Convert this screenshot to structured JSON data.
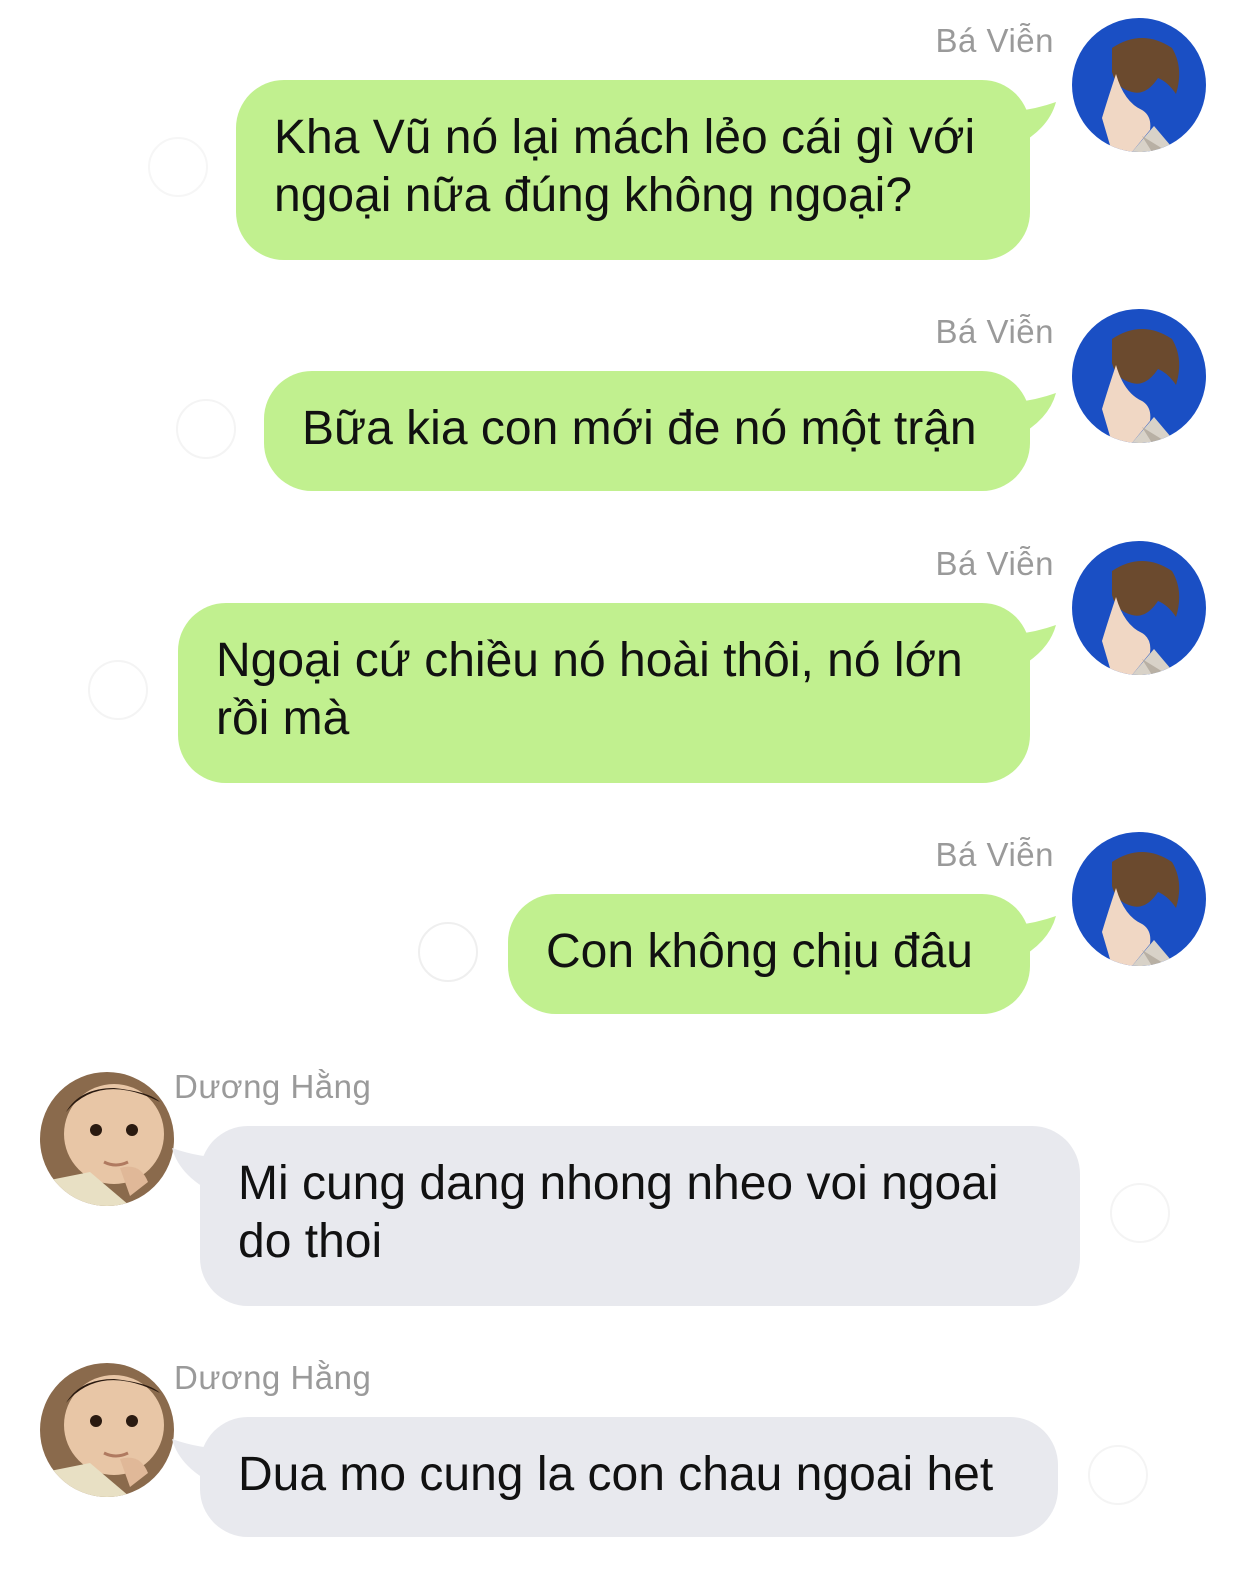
{
  "colors": {
    "outgoing_bubble": "#c1f08f",
    "incoming_bubble": "#e8e9ee",
    "sender_name": "#9a9a9a",
    "background": "#ffffff"
  },
  "messages": [
    {
      "direction": "outgoing",
      "sender": "Bá Viễn",
      "text": "Kha Vũ nó lại mách lẻo cái gì với\nngoại nữa đúng không ngoại?",
      "avatar": "boy-profile-blue-avatar"
    },
    {
      "direction": "outgoing",
      "sender": "Bá Viễn",
      "text": "Bữa kia con mới đe nó một trận",
      "avatar": "boy-profile-blue-avatar"
    },
    {
      "direction": "outgoing",
      "sender": "Bá Viễn",
      "text": "Ngoại cứ chiều nó hoài thôi, nó lớn\nrồi mà",
      "avatar": "boy-profile-blue-avatar"
    },
    {
      "direction": "outgoing",
      "sender": "Bá Viễn",
      "text": "Con không chịu đâu",
      "avatar": "boy-profile-blue-avatar"
    },
    {
      "direction": "incoming",
      "sender": "Dương Hằng",
      "text": "Mi cung dang nhong nheo voi ngoai\ndo thoi",
      "avatar": "child-thinking-avatar"
    },
    {
      "direction": "incoming",
      "sender": "Dương Hằng",
      "text": "Dua mo cung la con chau ngoai het",
      "avatar": "child-thinking-avatar"
    }
  ]
}
